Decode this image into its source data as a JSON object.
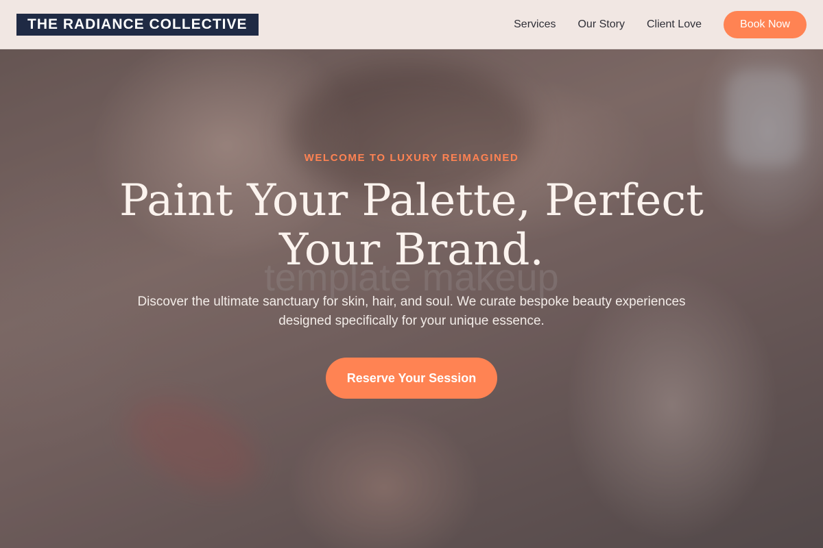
{
  "header": {
    "logo": "THE RADIANCE COLLECTIVE",
    "nav": [
      "Services",
      "Our Story",
      "Client Love"
    ],
    "cta_label": "Book Now"
  },
  "hero": {
    "eyebrow": "WELCOME TO LUXURY REIMAGINED",
    "headline": "Paint Your Palette, Perfect Your Brand.",
    "watermark": "template makeup",
    "subtitle": "Discover the ultimate sanctuary for skin, hair, and soul. We curate bespoke beauty experiences designed specifically for your unique essence.",
    "cta_label": "Reserve Your Session"
  },
  "colors": {
    "brand_navy": "#1f2a44",
    "accent": "#ff8353",
    "header_bg": "#f1e7e3"
  }
}
